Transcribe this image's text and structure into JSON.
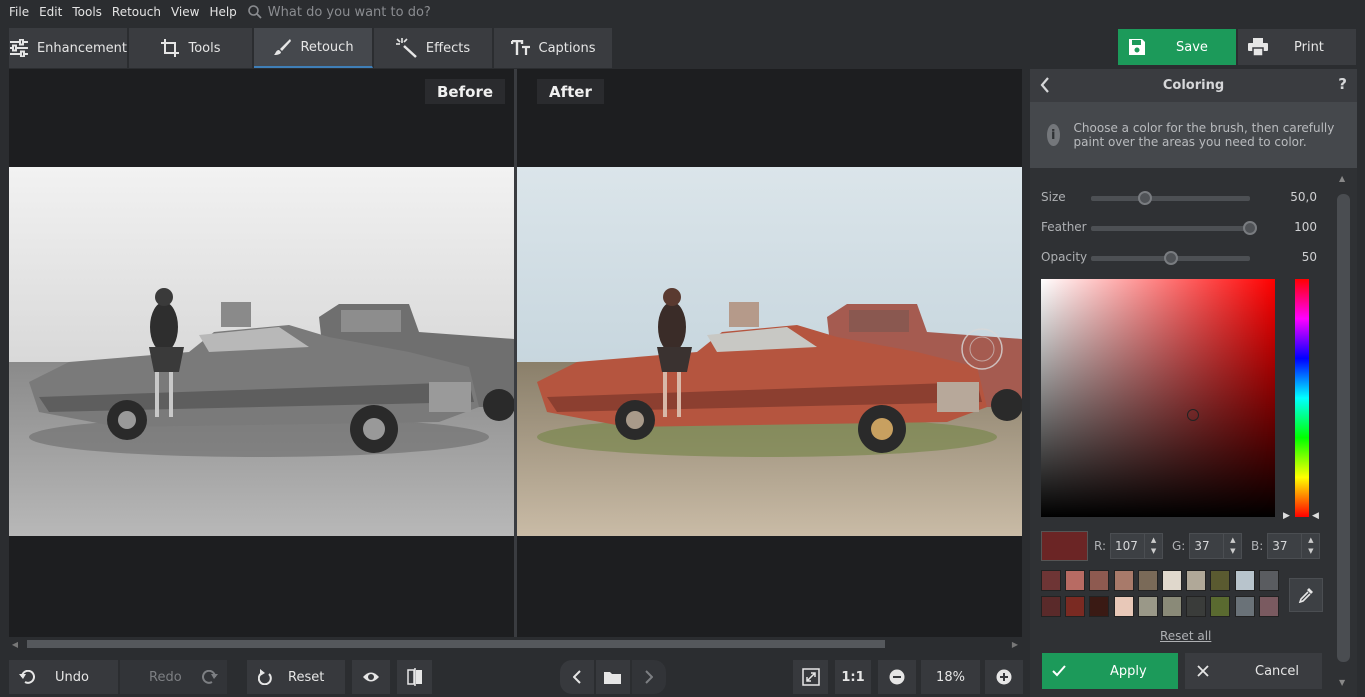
{
  "menu": [
    "File",
    "Edit",
    "Tools",
    "Retouch",
    "View",
    "Help"
  ],
  "search": {
    "placeholder": "What do you want to do?"
  },
  "tabs": [
    {
      "label": "Enhancement",
      "icon": "sliders-icon"
    },
    {
      "label": "Tools",
      "icon": "crop-icon"
    },
    {
      "label": "Retouch",
      "icon": "brush-icon",
      "active": true
    },
    {
      "label": "Effects",
      "icon": "magic-wand-icon"
    },
    {
      "label": "Captions",
      "icon": "text-icon"
    }
  ],
  "toolbar": {
    "save_label": "Save",
    "print_label": "Print"
  },
  "viewer": {
    "before_label": "Before",
    "after_label": "After"
  },
  "bottom": {
    "undo_label": "Undo",
    "redo_label": "Redo",
    "reset_label": "Reset",
    "actual_size_label": "1:1",
    "zoom_value": "18%"
  },
  "panel": {
    "title": "Coloring",
    "help": "?",
    "info_text": "Choose a color for the brush, then carefully paint over the areas you need to color.",
    "sliders": [
      {
        "label": "Size",
        "value": "50,0",
        "fraction": 0.34
      },
      {
        "label": "Feather",
        "value": "100",
        "fraction": 1.0
      },
      {
        "label": "Opacity",
        "value": "50",
        "fraction": 0.5
      }
    ],
    "current_color": "#6b2525",
    "rgb": {
      "r_label": "R:",
      "r": "107",
      "g_label": "G:",
      "g": "37",
      "b_label": "B:",
      "b": "37"
    },
    "palette": [
      "#6e3535",
      "#b86b63",
      "#8e5a50",
      "#a87a6a",
      "#7a6a58",
      "#e0d8cc",
      "#b0a898",
      "#5a5a30",
      "#b8c4cc",
      "#5a5c60",
      "#5a2a2a",
      "#7a2a22",
      "#3a1a14",
      "#e8c8b8",
      "#9a9888",
      "#8a8a78",
      "#3a3c3a",
      "#5a6a30",
      "#6a7278",
      "#7a5a60"
    ],
    "reset_all_label": "Reset all",
    "apply_label": "Apply",
    "cancel_label": "Cancel"
  }
}
